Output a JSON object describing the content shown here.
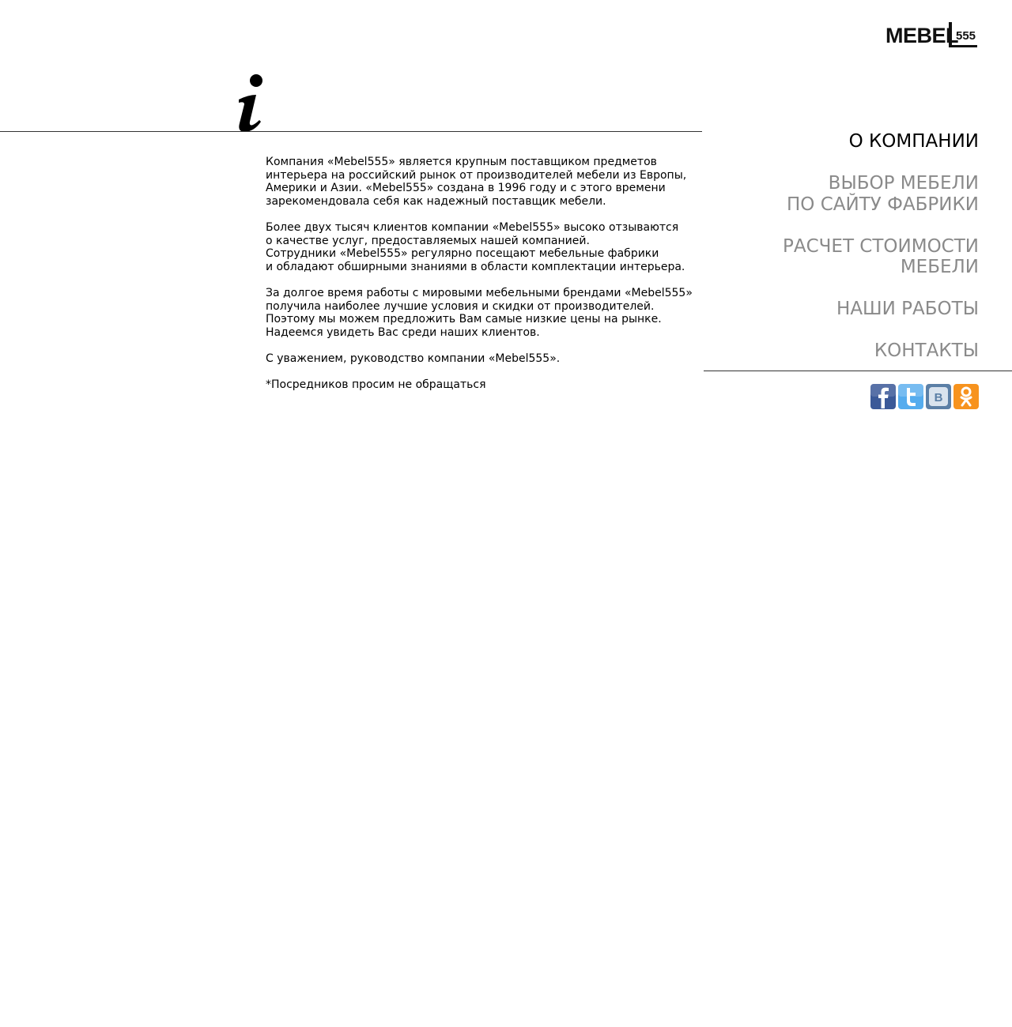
{
  "logo": {
    "brand": "MEBEL",
    "number": "555"
  },
  "content": {
    "paragraphs": [
      "Компания  «Mebel555» является крупным поставщиком предметов\nинтерьера на российский рынок от производителей мебели из Европы,\nАмерики и Азии.  «Mebel555» создана в 1996 году и с этого времени\nзарекомендовала себя как надежный поставщик мебели.",
      "Более двух тысяч клиентов компании «Mebel555» высоко отзываются\nо качестве услуг, предоставляемых нашей компанией.\nСотрудники «Mebel555» регулярно посещают мебельные фабрики\nи обладают обширными знаниями в области комплектации интерьера.",
      "За долгое время работы с мировыми мебельными брендами «Mebel555»\nполучила наиболее лучшие условия и скидки от производителей.\nПоэтому мы можем предложить Вам самые низкие цены на рынке.\nНадеемся увидеть Вас среди наших клиентов.",
      "С уважением, руководство компании «Mebel555».",
      "*Посредников просим не обращаться"
    ]
  },
  "nav": {
    "items": [
      {
        "label": "О КОМПАНИИ",
        "active": true
      },
      {
        "label": "ВЫБОР МЕБЕЛИ\nПО САЙТУ ФАБРИКИ",
        "active": false
      },
      {
        "label": "РАСЧЕТ СТОИМОСТИ\nМЕБЕЛИ",
        "active": false
      },
      {
        "label": "НАШИ РАБОТЫ",
        "active": false
      },
      {
        "label": "КОНТАКТЫ",
        "active": false
      }
    ]
  },
  "social": [
    {
      "icon": "facebook-icon",
      "color": "#3b5998"
    },
    {
      "icon": "twitter-icon",
      "color": "#55acee"
    },
    {
      "icon": "vkontakte-icon",
      "color": "#5b7fa6"
    },
    {
      "icon": "odnoklassniki-icon",
      "color": "#f7931e"
    }
  ]
}
